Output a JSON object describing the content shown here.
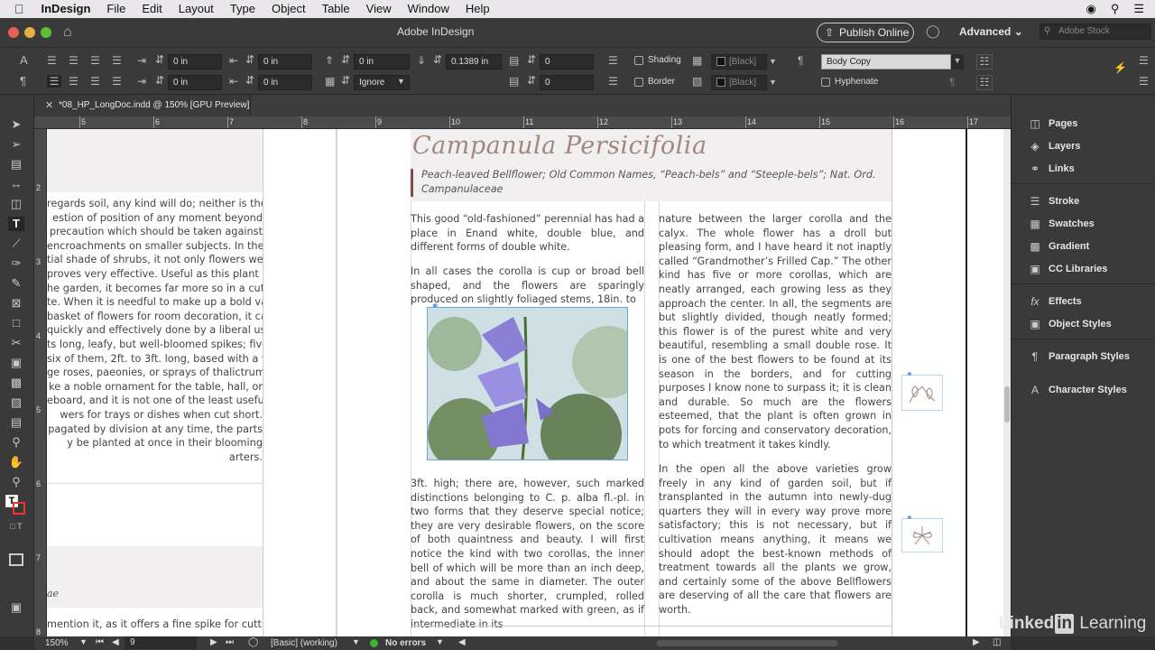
{
  "menubar": {
    "items": [
      "InDesign",
      "File",
      "Edit",
      "Layout",
      "Type",
      "Object",
      "Table",
      "View",
      "Window",
      "Help"
    ]
  },
  "appbar": {
    "title": "Adobe InDesign",
    "publish_label": "Publish Online",
    "workspace": "Advanced",
    "search_placeholder": "Adobe Stock"
  },
  "control": {
    "left_indent": "0 in",
    "first_line_indent": "0 in",
    "right_indent": "0 in",
    "last_line_indent": "0 in",
    "space_before": "0 in",
    "space_after": "0.1389 in",
    "align_grid": "Ignore",
    "drop_cap_lines": "0",
    "drop_cap_chars": "0",
    "shading_label": "Shading",
    "border_label": "Border",
    "shading_swatch": "[Black]",
    "border_swatch": "[Black]",
    "para_style": "Body Copy",
    "hyphenate_label": "Hyphenate"
  },
  "tab": {
    "title": "*08_HP_LongDoc.indd @ 150% [GPU Preview]"
  },
  "ruler": {
    "h_marks": [
      "5",
      "6",
      "7",
      "8",
      "9",
      "10",
      "11",
      "12",
      "13",
      "14",
      "15",
      "16",
      "17"
    ],
    "v_marks": [
      "2",
      "3",
      "4",
      "5",
      "6",
      "7",
      "8"
    ]
  },
  "left_page": {
    "lines": [
      "regards soil, any kind will do; neither is the",
      "estion of position of any moment beyond",
      "precaution which should be taken against",
      "encroachments on smaller subjects. In the",
      "tial shade of shrubs, it not only flowers well",
      "proves very effective. Useful as this plant is",
      "he garden, it becomes far more so in a cut",
      "te. When it is needful to make up a bold vase",
      "basket of flowers for room decoration, it can",
      "quickly and effectively done by a liberal use",
      "ts long, leafy, but well-bloomed spikes; five",
      "six of them, 2ft. to 3ft. long, based with a few",
      "ge roses, paeonies, or sprays of thalictrum,",
      "ke a noble ornament for the table, hall, or",
      "eboard, and it is not one of the least useful",
      "wers for trays or dishes when cut short.",
      "pagated by division at any time, the parts",
      "y be planted at once in their blooming",
      "arters."
    ],
    "caption_fragment": "ae",
    "bottom_line": "mention it, as it offers a fine spike for cutting"
  },
  "article": {
    "title": "Campanula Persicifolia",
    "subtitle": "Peach-leaved Bellflower; Old Common Names, “Peach-bels” and “Steeple-bels”; Nat. Ord. Campanulaceae",
    "col1_p1": "This good “old-fashioned” perennial has had a place in Enand white, double blue, and different forms of double white.",
    "col1_p2": "In all cases the corolla is cup or broad bell shaped, and the flowers are sparingly produced on slightly foliaged stems, 18in. to",
    "col1_p3": "3ft. high; there are, however, such marked distinctions belonging to C. p. alba fl.-pl. in two forms that they deserve special notice; they are very desirable flowers, on the score of both quaintness and beauty. I will first notice the kind with two corollas, the inner bell of which will be more than an inch deep, and about the same in diameter. The outer corolla is much shorter, crumpled, rolled back, and somewhat marked with green, as if intermediate in its",
    "col2_p1": "nature between the larger corolla and the calyx. The whole flower has a droll but pleasing form, and I have heard it not inaptly called “Grandmother’s Frilled Cap.” The other kind has five or more corollas, which are neatly arranged, each growing less as they approach the center. In all, the segments are but slightly divided, though neatly formed; this flower is of the purest white and very beautiful, resembling a small double rose. It is one of the best flowers to be found at its season in the borders, and for cutting purposes I know none to surpass it; it is clean and durable. So much are the flowers esteemed, that the plant is often grown in pots for forcing and conservatory decoration, to which treatment it takes kindly.",
    "col2_p2": "In the open all the above varieties grow freely in any kind of garden soil, but if transplanted in the autumn into newly-dug quarters they will in every way prove more satisfactory; this is not necessary, but if cultivation means anything, it means we should adopt the best-known methods of treatment towards all the plants we grow, and certainly some of the above Bellflowers are deserving of all the care that flowers are worth."
  },
  "panels": {
    "items": [
      "Pages",
      "Layers",
      "Links",
      "Stroke",
      "Swatches",
      "Gradient",
      "CC Libraries",
      "Effects",
      "Object Styles",
      "Paragraph Styles",
      "Character Styles"
    ]
  },
  "status": {
    "zoom": "150%",
    "page": "9",
    "profile": "[Basic] (working)",
    "errors": "No errors"
  },
  "watermark": "Linked in Learning",
  "colors": {
    "accent_title": "#a1887f",
    "no_errors_dot": "#3ab53a"
  }
}
